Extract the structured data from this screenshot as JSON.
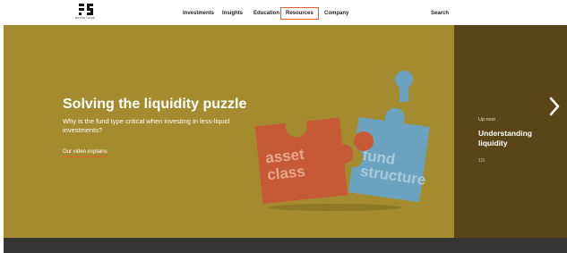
{
  "header": {
    "logo_text": "BRAND NAME",
    "nav": [
      "Investments",
      "Insights",
      "Education",
      "Resources",
      "Company"
    ],
    "active_nav": "Resources",
    "search_label": "Search"
  },
  "hero": {
    "title": "Solving the liquidity puzzle",
    "description": "Why is the fund type critical when investing in less-liquid investments?",
    "link": "Our video explains",
    "puzzle_left_text": [
      "asset",
      "class"
    ],
    "puzzle_right_text": [
      "fund",
      "structure"
    ]
  },
  "side": {
    "up_next": "Up next",
    "title": "Understanding liquidity",
    "count": "1/3"
  },
  "icons": {
    "next": "chevron-right-icon"
  },
  "colors": {
    "hero_bg": "#a58b2f",
    "side_bg": "#5a4519",
    "accent": "#e2622a",
    "puzzle_orange": "#c65a36",
    "puzzle_blue": "#6aa2bf"
  }
}
